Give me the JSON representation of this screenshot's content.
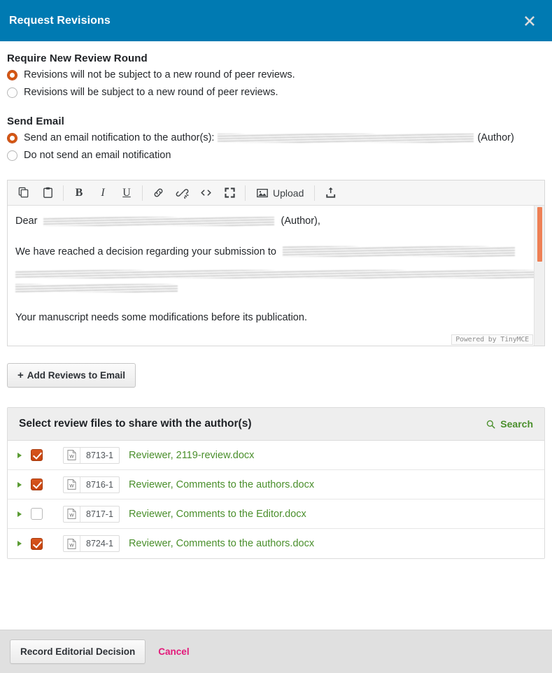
{
  "header": {
    "title": "Request Revisions",
    "close_icon": "close-x-icon",
    "background_color": "#007ab2"
  },
  "sections": {
    "review_round": {
      "title": "Require New Review Round",
      "options": [
        {
          "label": "Revisions will not be subject to a new round of peer reviews.",
          "selected": true
        },
        {
          "label": "Revisions will be subject to a new round of peer reviews.",
          "selected": false
        }
      ]
    },
    "send_email": {
      "title": "Send Email",
      "options": [
        {
          "label_prefix": "Send an email notification to the author(s):",
          "redacted_recipient": true,
          "label_suffix": "(Author)",
          "selected": true
        },
        {
          "label_prefix": "Do not send an email notification",
          "redacted_recipient": false,
          "label_suffix": "",
          "selected": false
        }
      ]
    }
  },
  "editor": {
    "toolbar": [
      {
        "name": "copy-icon",
        "label": "",
        "type": "icon"
      },
      {
        "name": "paste-icon",
        "label": "",
        "type": "icon"
      },
      {
        "name": "separator",
        "label": "",
        "type": "sep"
      },
      {
        "name": "bold-icon",
        "label": "B",
        "type": "text-b"
      },
      {
        "name": "italic-icon",
        "label": "I",
        "type": "text-i"
      },
      {
        "name": "underline-icon",
        "label": "U",
        "type": "text-u"
      },
      {
        "name": "separator",
        "label": "",
        "type": "sep"
      },
      {
        "name": "link-icon",
        "label": "",
        "type": "icon"
      },
      {
        "name": "unlink-icon",
        "label": "",
        "type": "icon"
      },
      {
        "name": "source-code-icon",
        "label": "",
        "type": "icon"
      },
      {
        "name": "fullscreen-icon",
        "label": "",
        "type": "icon"
      },
      {
        "name": "separator",
        "label": "",
        "type": "sep"
      },
      {
        "name": "image-upload-icon",
        "label": "Upload",
        "type": "wide"
      },
      {
        "name": "separator",
        "label": "",
        "type": "sep"
      },
      {
        "name": "insert-file-icon",
        "label": "",
        "type": "icon"
      }
    ],
    "body": {
      "greeting_prefix": "Dear",
      "greeting_suffix": "(Author),",
      "paragraph_2_prefix": "We have reached a decision regarding your submission to",
      "paragraph_3": "Your manuscript needs some modifications before its publication."
    },
    "badge": "Powered by TinyMCE",
    "scrollbar_thumb_color": "#ee8055"
  },
  "add_reviews_button": {
    "label": "Add Reviews to Email",
    "plus": "+"
  },
  "files_panel": {
    "title": "Select review files to share with the author(s)",
    "search_label": "Search",
    "search_icon": "search-icon",
    "rows": [
      {
        "checked": true,
        "file_id": "8713-1",
        "file_name": "Reviewer, 2119-review.docx",
        "icon": "word-document-icon"
      },
      {
        "checked": true,
        "file_id": "8716-1",
        "file_name": "Reviewer, Comments to the authors.docx",
        "icon": "word-document-icon"
      },
      {
        "checked": false,
        "file_id": "8717-1",
        "file_name": "Reviewer, Comments to the Editor.docx",
        "icon": "word-document-icon"
      },
      {
        "checked": true,
        "file_id": "8724-1",
        "file_name": "Reviewer, Comments to the authors.docx",
        "icon": "word-document-icon"
      }
    ]
  },
  "footer": {
    "submit_label": "Record Editorial Decision",
    "cancel_label": "Cancel",
    "cancel_color": "#e3197a"
  },
  "colors": {
    "accent_blue": "#007ab2",
    "accent_orange": "#d4540f",
    "link_green": "#4a8f2c",
    "cancel_pink": "#e3197a"
  }
}
